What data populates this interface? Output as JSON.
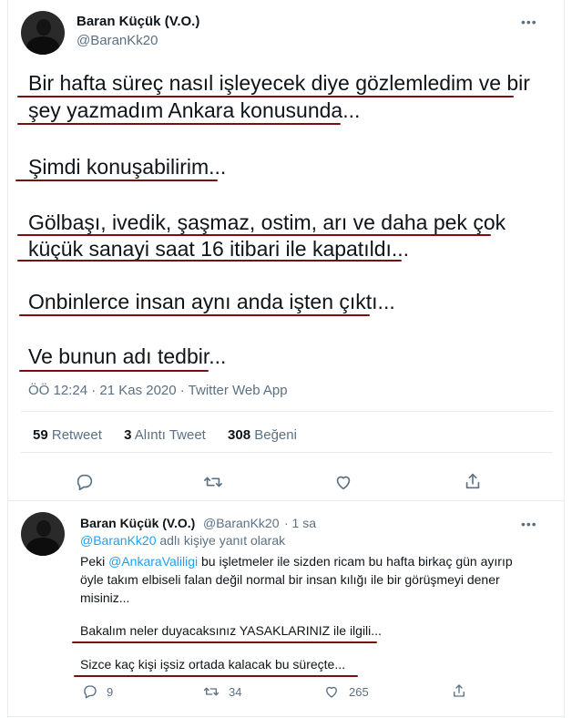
{
  "main_tweet": {
    "display_name": "Baran Küçük (V.O.)",
    "handle": "@BaranKk20",
    "more_icon": "more-dots-icon",
    "lines": [
      "Bir hafta süreç nasıl işleyecek diye gözlemledim ve bir",
      "şey yazmadım Ankara konusunda...",
      "Şimdi konuşabilirim...",
      "Gölbaşı, ivedik, şaşmaz, ostim, arı ve daha pek çok",
      "küçük sanayi saat 16 itibari ile kapatıldı...",
      "Onbinlerce insan aynı anda işten çıktı...",
      "Ve bunun adı tedbir..."
    ],
    "meta": "ÖÖ 12:24 · 21 Kas 2020 · Twitter Web App",
    "stats": {
      "retweet_count": "59",
      "retweet_label": "Retweet",
      "quote_count": "3",
      "quote_label": "Alıntı Tweet",
      "like_count": "308",
      "like_label": "Beğeni"
    },
    "underline_color": "#7a0f10"
  },
  "reply_tweet": {
    "display_name": "Baran Küçük (V.O.)",
    "handle": "@BaranKk20",
    "time": "· 1 sa",
    "reply_to_mention": "@BaranKk20",
    "reply_to_rest": " adlı kişiye yanıt olarak",
    "text_line1_prefix": "Peki ",
    "text_line1_mention": "@AnkaraValiligi",
    "text_line1_rest": " bu işletmeler ile sizden ricam bu hafta birkaç gün ayırıp",
    "text_line2": "öyle takım elbiseli falan değil normal bir insan kılığı ile bir görüşmeyi dener",
    "text_line3": "misiniz...",
    "text_line4": "Bakalım neler duyacaksınız YASAKLARINIZ ile ilgili...",
    "text_line5": "Sizce kaç kişi işsiz ortada kalacak bu süreçte...",
    "reply_count": "9",
    "retweet_count": "34",
    "like_count": "265"
  },
  "colors": {
    "accent": "#1da1f2",
    "text": "#0f1419",
    "muted": "#5b7083",
    "divider": "#e6ecf0"
  }
}
